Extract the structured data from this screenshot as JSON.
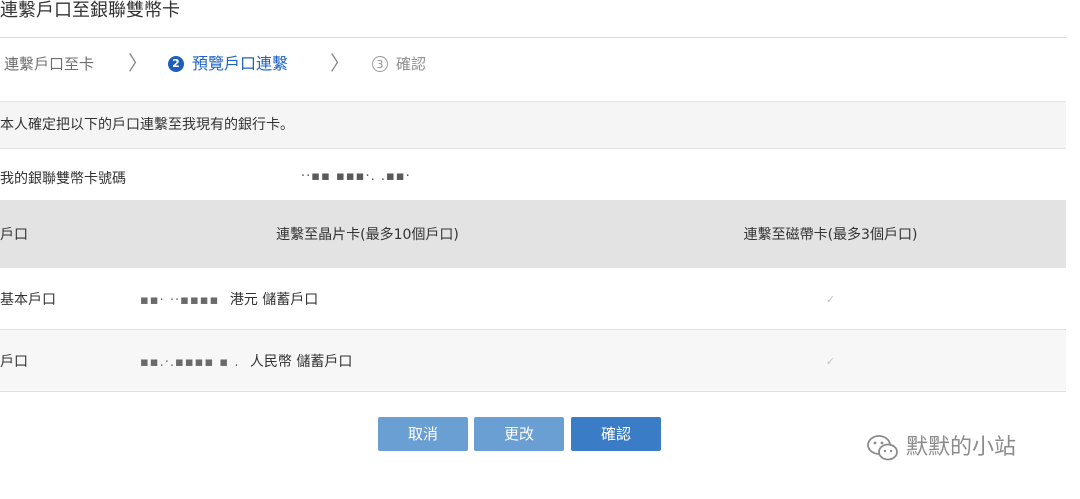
{
  "page": {
    "title": "連繫戶口至銀聯雙幣卡"
  },
  "steps": [
    {
      "label": "連繫戶口至卡",
      "number": "",
      "state": "done"
    },
    {
      "label": "預覽戶口連繫",
      "number": "2",
      "state": "active"
    },
    {
      "label": "確認",
      "number": "3",
      "state": "pending"
    }
  ],
  "confirm_text": "本人確定把以下的戶口連繫至我現有的銀行卡。",
  "card": {
    "label": "我的銀聯雙幣卡號碼",
    "value": "··▪▪ ▪▪▪·. .▪▪·"
  },
  "table": {
    "headers": {
      "account": "戶口",
      "chip": "連繫至晶片卡(最多10個戶口)",
      "magnetic": "連繫至磁帶卡(最多3個戶口)"
    },
    "rows": [
      {
        "account": "基本戶口",
        "masked": "▪▪· ··▪▪▪▪",
        "detail": "港元 儲蓄戶口",
        "magnetic_checked": true
      },
      {
        "account": "戶口",
        "masked": "▪▪.·.▪▪▪▪ ▪ .",
        "detail": "人民幣 儲蓄戶口",
        "magnetic_checked": true
      }
    ]
  },
  "buttons": {
    "cancel": "取消",
    "modify": "更改",
    "confirm": "確認"
  },
  "watermark": {
    "text": "默默的小站",
    "icon": "wechat-icon"
  },
  "colors": {
    "accent": "#1f63c6",
    "button": "#6a9fd3",
    "button_primary": "#3a7cc6",
    "header_bg": "#e3e3e3"
  }
}
